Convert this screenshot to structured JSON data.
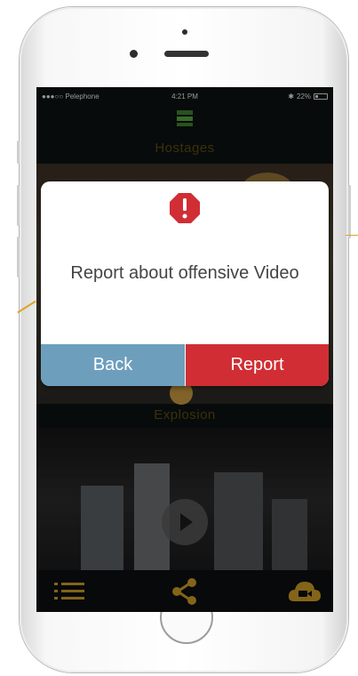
{
  "status_bar": {
    "carrier": "●●●○○ Pelephone",
    "time": "4:21 PM",
    "battery": "22%"
  },
  "sections": {
    "top_title": "Hostages",
    "bottom_title": "Explosion"
  },
  "dialog": {
    "message": "Report about offensive Video",
    "back_label": "Back",
    "report_label": "Report"
  },
  "icons": {
    "alert": "alert-octagon-icon",
    "play": "play-icon",
    "menu": "list-menu-icon",
    "share": "share-icon",
    "upload": "camera-cloud-icon"
  },
  "colors": {
    "back_button": "#6d9fbd",
    "report_button": "#d02e34",
    "alert_icon": "#d02e34",
    "accent_gold": "#e0a22b"
  }
}
